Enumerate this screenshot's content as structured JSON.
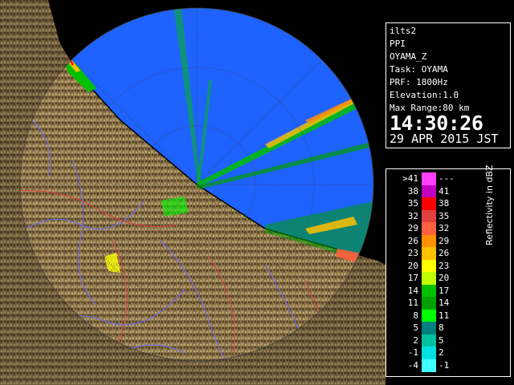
{
  "info": {
    "site": "ilts2",
    "scan_type": "PPI",
    "product": "OYAMA_Z",
    "task": "Task: OYAMA",
    "prf": "PRF: 1800Hz",
    "elevation": "Elevation:1.0",
    "max_range": "Max Range:80 km",
    "time": "14:30:26",
    "date": "29 APR 2015 JST"
  },
  "legend": {
    "unit_label": "Reflectivity in dBZ",
    "bins": [
      {
        "low": ">41",
        "high": "---",
        "color": "#ff40ff"
      },
      {
        "low": "38",
        "high": "41",
        "color": "#c000c0"
      },
      {
        "low": "35",
        "high": "38",
        "color": "#ff0000"
      },
      {
        "low": "32",
        "high": "35",
        "color": "#e04040"
      },
      {
        "low": "29",
        "high": "32",
        "color": "#ff6040"
      },
      {
        "low": "26",
        "high": "29",
        "color": "#ff9000"
      },
      {
        "low": "23",
        "high": "26",
        "color": "#ffc000"
      },
      {
        "low": "20",
        "high": "23",
        "color": "#ffff00"
      },
      {
        "low": "17",
        "high": "20",
        "color": "#c0ff00"
      },
      {
        "low": "14",
        "high": "17",
        "color": "#00c000"
      },
      {
        "low": "11",
        "high": "14",
        "color": "#00a000"
      },
      {
        "low": "8",
        "high": "11",
        "color": "#00ff00"
      },
      {
        "low": "5",
        "high": "8",
        "color": "#008080"
      },
      {
        "low": "2",
        "high": "5",
        "color": "#00c0a0"
      },
      {
        "low": "-1",
        "high": "2",
        "color": "#00e0e0"
      },
      {
        "low": "-4",
        "high": "-1",
        "color": "#40ffff"
      }
    ]
  },
  "colors": {
    "ocean": "#1e62ff",
    "land": "#8a7348",
    "rivers": "#6a6aff",
    "borders": "#e04040",
    "range_rings": "#404040",
    "coastline": "#000000"
  }
}
